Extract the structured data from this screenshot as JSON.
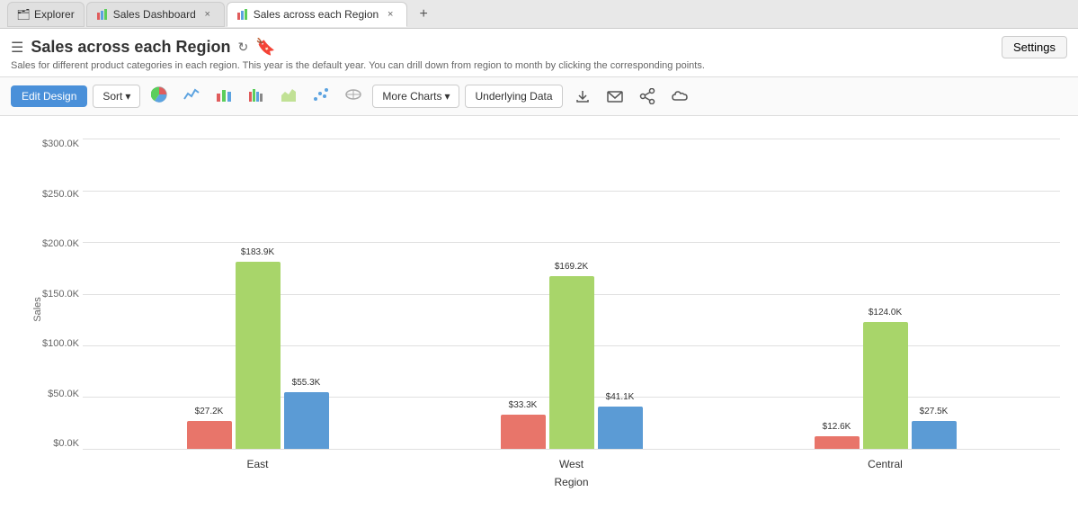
{
  "tabs": [
    {
      "id": "explorer",
      "label": "Explorer",
      "icon": "🗂",
      "active": false,
      "closable": false
    },
    {
      "id": "sales-dashboard",
      "label": "Sales Dashboard",
      "icon": "📊",
      "active": false,
      "closable": true
    },
    {
      "id": "sales-region",
      "label": "Sales across each Region",
      "icon": "📊",
      "active": true,
      "closable": true
    }
  ],
  "header": {
    "title": "Sales across each Region",
    "subtitle": "Sales for different product categories in each region. This year is the default year. You can drill down from region to month by clicking the corresponding points.",
    "settings_label": "Settings"
  },
  "toolbar": {
    "edit_design_label": "Edit Design",
    "sort_label": "Sort",
    "more_charts_label": "More Charts",
    "underlying_data_label": "Underlying Data"
  },
  "chart": {
    "y_axis_title": "Sales",
    "x_axis_title": "Region",
    "y_labels": [
      "$300.0K",
      "$250.0K",
      "$200.0K",
      "$150.0K",
      "$100.0K",
      "$50.0K",
      "$0.0K"
    ],
    "max_value": 300000,
    "regions": [
      {
        "name": "East",
        "bars": [
          {
            "color": "red",
            "value": 27200,
            "label": "$27.2K"
          },
          {
            "color": "green",
            "value": 183900,
            "label": "$183.9K"
          },
          {
            "color": "blue",
            "value": 55300,
            "label": "$55.3K"
          }
        ]
      },
      {
        "name": "West",
        "bars": [
          {
            "color": "red",
            "value": 33300,
            "label": "$33.3K"
          },
          {
            "color": "green",
            "value": 169200,
            "label": "$169.2K"
          },
          {
            "color": "blue",
            "value": 41100,
            "label": "$41.1K"
          }
        ]
      },
      {
        "name": "Central",
        "bars": [
          {
            "color": "red",
            "value": 12600,
            "label": "$12.6K"
          },
          {
            "color": "green",
            "value": 124000,
            "label": "$124.0K"
          },
          {
            "color": "blue",
            "value": 27500,
            "label": "$27.5K"
          }
        ]
      }
    ]
  }
}
